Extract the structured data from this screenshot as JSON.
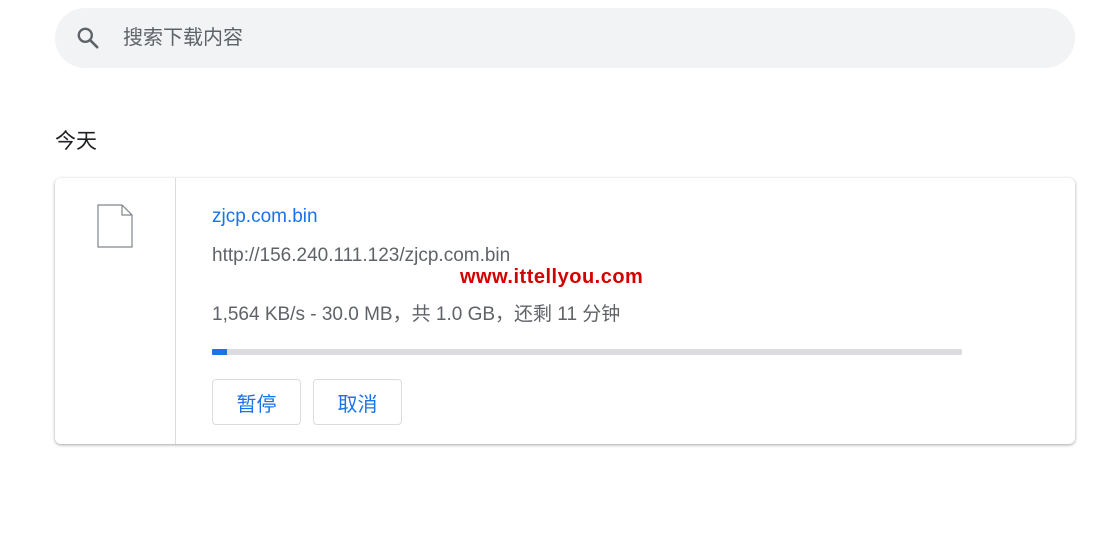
{
  "search": {
    "placeholder": "搜索下载内容",
    "icon": "search-icon"
  },
  "section": {
    "title": "今天"
  },
  "download": {
    "icon": "file-icon",
    "file_name": "zjcp.com.bin",
    "url": "http://156.240.111.123/zjcp.com.bin",
    "watermark": "www.ittellyou.com",
    "status": "1,564 KB/s - 30.0 MB，共 1.0 GB，还剩 11 分钟",
    "progress_fraction": 0.02,
    "buttons": {
      "pause_label": "暂停",
      "cancel_label": "取消"
    }
  },
  "colors": {
    "accent": "#1a73e8",
    "secondary_text": "#5f6368",
    "search_background": "#f1f3f4",
    "progress_track": "#dadce0",
    "watermark": "#d40000"
  }
}
